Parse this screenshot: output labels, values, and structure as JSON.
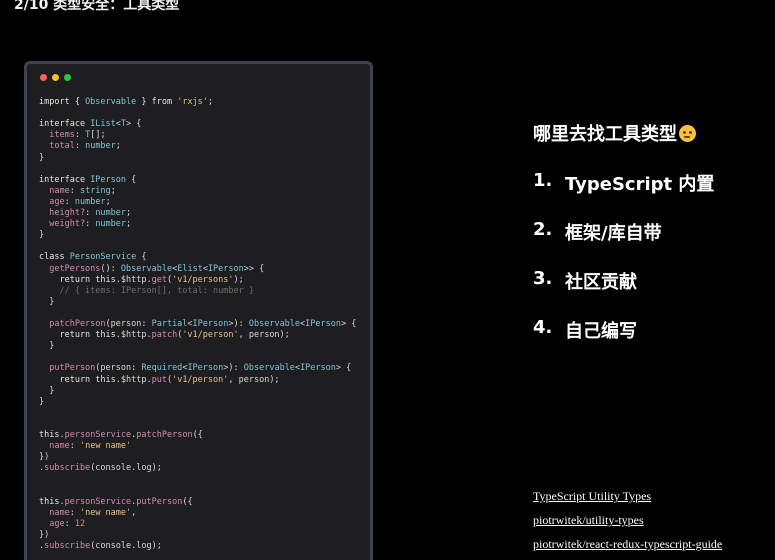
{
  "slide": {
    "title": "2/10 类型安全：工具类型"
  },
  "code": {
    "lines": [
      [
        [
          "kw",
          "import { "
        ],
        [
          "type",
          "Observable"
        ],
        [
          "kw",
          " } from "
        ],
        [
          "str",
          "'rxjs'"
        ],
        [
          "pl",
          ";"
        ]
      ],
      [],
      [
        [
          "kw",
          "interface "
        ],
        [
          "type",
          "IList"
        ],
        [
          "pl",
          "<"
        ],
        [
          "type",
          "T"
        ],
        [
          "pl",
          "> {"
        ]
      ],
      [
        [
          "prop",
          "  items"
        ],
        [
          "pl",
          ": "
        ],
        [
          "type",
          "T"
        ],
        [
          "pl",
          "[];"
        ]
      ],
      [
        [
          "prop",
          "  total"
        ],
        [
          "pl",
          ": "
        ],
        [
          "type",
          "number"
        ],
        [
          "pl",
          ";"
        ]
      ],
      [
        [
          "pl",
          "}"
        ]
      ],
      [],
      [
        [
          "kw",
          "interface "
        ],
        [
          "type",
          "IPerson"
        ],
        [
          "pl",
          " {"
        ]
      ],
      [
        [
          "prop",
          "  name"
        ],
        [
          "pl",
          ": "
        ],
        [
          "type",
          "string"
        ],
        [
          "pl",
          ";"
        ]
      ],
      [
        [
          "prop",
          "  age"
        ],
        [
          "pl",
          ": "
        ],
        [
          "type",
          "number"
        ],
        [
          "pl",
          ";"
        ]
      ],
      [
        [
          "prop",
          "  height?"
        ],
        [
          "pl",
          ": "
        ],
        [
          "type",
          "number"
        ],
        [
          "pl",
          ";"
        ]
      ],
      [
        [
          "prop",
          "  weight?"
        ],
        [
          "pl",
          ": "
        ],
        [
          "type",
          "number"
        ],
        [
          "pl",
          ";"
        ]
      ],
      [
        [
          "pl",
          "}"
        ]
      ],
      [],
      [
        [
          "kw",
          "class "
        ],
        [
          "type",
          "PersonService"
        ],
        [
          "pl",
          " {"
        ]
      ],
      [
        [
          "prop",
          "  getPersons"
        ],
        [
          "pl",
          "(): "
        ],
        [
          "type",
          "Observable"
        ],
        [
          "pl",
          "<"
        ],
        [
          "type",
          "Elist"
        ],
        [
          "pl",
          "<"
        ],
        [
          "type",
          "IPerson"
        ],
        [
          "pl",
          ">> {"
        ]
      ],
      [
        [
          "kw",
          "    return this"
        ],
        [
          "pl",
          ".$http."
        ],
        [
          "prop",
          "get"
        ],
        [
          "pl",
          "("
        ],
        [
          "str",
          "'v1/persons'"
        ],
        [
          "pl",
          ");"
        ]
      ],
      [
        [
          "cm",
          "    // { items: IPerson[], total: number }"
        ]
      ],
      [
        [
          "pl",
          "  }"
        ]
      ],
      [],
      [
        [
          "prop",
          "  patchPerson"
        ],
        [
          "pl",
          "(person: "
        ],
        [
          "type",
          "Partial"
        ],
        [
          "pl",
          "<"
        ],
        [
          "type",
          "IPerson"
        ],
        [
          "pl",
          ">): "
        ],
        [
          "type",
          "Observable"
        ],
        [
          "pl",
          "<"
        ],
        [
          "type",
          "IPerson"
        ],
        [
          "pl",
          "> {"
        ]
      ],
      [
        [
          "kw",
          "    return this"
        ],
        [
          "pl",
          ".$http."
        ],
        [
          "prop",
          "patch"
        ],
        [
          "pl",
          "("
        ],
        [
          "str",
          "'v1/person'"
        ],
        [
          "pl",
          ", person);"
        ]
      ],
      [
        [
          "pl",
          "  }"
        ]
      ],
      [],
      [
        [
          "prop",
          "  putPerson"
        ],
        [
          "pl",
          "(person: "
        ],
        [
          "type",
          "Required"
        ],
        [
          "pl",
          "<"
        ],
        [
          "type",
          "IPerson"
        ],
        [
          "pl",
          ">): "
        ],
        [
          "type",
          "Observable"
        ],
        [
          "pl",
          "<"
        ],
        [
          "type",
          "IPerson"
        ],
        [
          "pl",
          "> {"
        ]
      ],
      [
        [
          "kw",
          "    return this"
        ],
        [
          "pl",
          ".$http."
        ],
        [
          "prop",
          "put"
        ],
        [
          "pl",
          "("
        ],
        [
          "str",
          "'v1/person'"
        ],
        [
          "pl",
          ", person);"
        ]
      ],
      [
        [
          "pl",
          "  }"
        ]
      ],
      [
        [
          "pl",
          "}"
        ]
      ],
      [],
      [],
      [
        [
          "kw",
          "this"
        ],
        [
          "pl",
          "."
        ],
        [
          "prop",
          "personService"
        ],
        [
          "pl",
          "."
        ],
        [
          "prop",
          "patchPerson"
        ],
        [
          "pl",
          "({"
        ]
      ],
      [
        [
          "prop",
          "  name"
        ],
        [
          "pl",
          ": "
        ],
        [
          "str",
          "'new name'"
        ]
      ],
      [
        [
          "pl",
          "})"
        ]
      ],
      [
        [
          "pl",
          "."
        ],
        [
          "prop",
          "subscribe"
        ],
        [
          "pl",
          "(console.log);"
        ]
      ],
      [],
      [],
      [
        [
          "kw",
          "this"
        ],
        [
          "pl",
          "."
        ],
        [
          "prop",
          "personService"
        ],
        [
          "pl",
          "."
        ],
        [
          "prop",
          "putPerson"
        ],
        [
          "pl",
          "({"
        ]
      ],
      [
        [
          "prop",
          "  name"
        ],
        [
          "pl",
          ": "
        ],
        [
          "str",
          "'new name'"
        ],
        [
          "pl",
          ","
        ]
      ],
      [
        [
          "prop",
          "  age"
        ],
        [
          "pl",
          ": "
        ],
        [
          "num",
          "12"
        ]
      ],
      [
        [
          "pl",
          "})"
        ]
      ],
      [
        [
          "pl",
          "."
        ],
        [
          "prop",
          "subscribe"
        ],
        [
          "pl",
          "(console.log);"
        ]
      ]
    ]
  },
  "sidebar": {
    "heading": "哪里去找工具类型",
    "heading_icon": "thinking-face-emoji",
    "items": [
      {
        "num": "1.",
        "label": "TypeScript 内置"
      },
      {
        "num": "2.",
        "label": "框架/库自带"
      },
      {
        "num": "3.",
        "label": "社区贡献"
      },
      {
        "num": "4.",
        "label": "自己编写"
      }
    ],
    "links": [
      "TypeScript Utility Types",
      "piotrwitek/utility-types",
      "piotrwitek/react-redux-typescript-guide"
    ]
  }
}
